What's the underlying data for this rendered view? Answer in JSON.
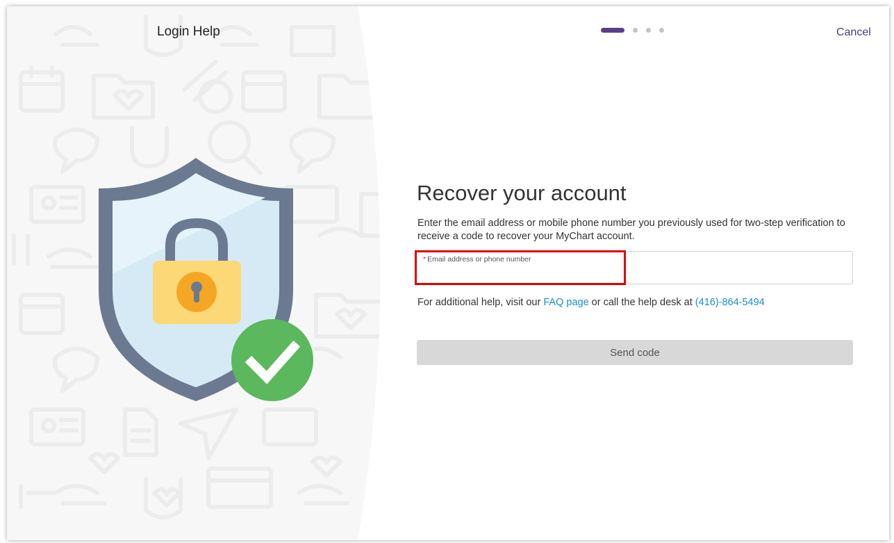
{
  "header": {
    "title": "Login Help",
    "cancel_label": "Cancel",
    "steps_total": 4,
    "current_step": 1
  },
  "main": {
    "heading": "Recover your account",
    "description": "Enter the email address or mobile phone number you previously used for two-step verification to receive a code to recover your MyChart account.",
    "field": {
      "required_mark": "*",
      "label": "Email address or phone number",
      "value": ""
    },
    "help": {
      "prefix": "For additional help, visit our ",
      "faq_link": "FAQ page",
      "middle": " or call the help desk at ",
      "phone_link": "(416)-864-5494"
    },
    "send_button": "Send code"
  },
  "colors": {
    "accent_purple": "#5a3e8a",
    "link_blue": "#1a8ec9",
    "shield_dark": "#6b7a91",
    "shield_light": "#d6eaf5",
    "lock_yellow": "#fcd877",
    "check_green": "#5cb85c",
    "highlight_red": "#e00000"
  },
  "icons": [
    "shield-lock-illustration",
    "padlock-icon",
    "checkmark-icon",
    "background-pattern-icons"
  ]
}
